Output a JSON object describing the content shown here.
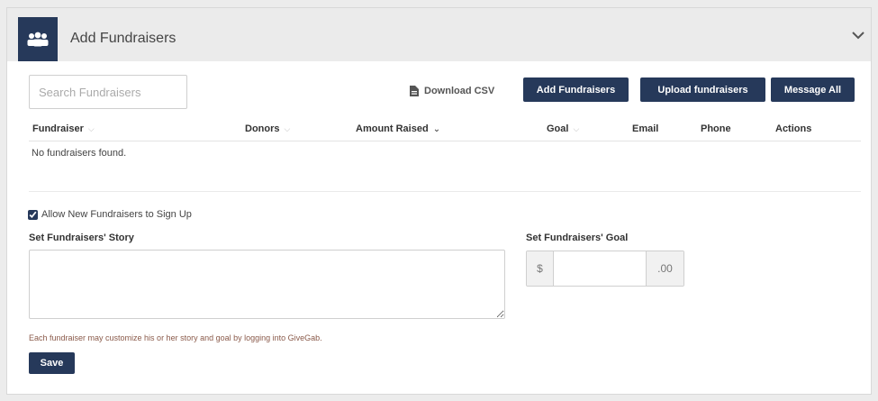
{
  "header": {
    "title": "Add Fundraisers",
    "icon": "group-icon",
    "collapse_icon": "chevron-down-icon"
  },
  "toolbar": {
    "search_placeholder": "Search Fundraisers",
    "download_label": "Download CSV",
    "download_icon": "document-icon",
    "add_label": "Add Fundraisers",
    "upload_label": "Upload fundraisers",
    "message_label": "Message All"
  },
  "table": {
    "columns": [
      {
        "label": "Fundraiser",
        "sortable": true,
        "active": false
      },
      {
        "label": "Donors",
        "sortable": true,
        "active": false
      },
      {
        "label": "Amount Raised",
        "sortable": true,
        "active": true
      },
      {
        "label": "Goal",
        "sortable": true,
        "active": false
      },
      {
        "label": "Email",
        "sortable": false,
        "active": false
      },
      {
        "label": "Phone",
        "sortable": false,
        "active": false
      },
      {
        "label": "Actions",
        "sortable": false,
        "active": false
      }
    ],
    "empty_message": "No fundraisers found."
  },
  "settings": {
    "allow_signup_label": "Allow New Fundraisers to Sign Up",
    "allow_signup_checked": true,
    "story_label": "Set Fundraisers' Story",
    "story_value": "",
    "goal_label": "Set Fundraisers' Goal",
    "goal_prefix": "$",
    "goal_value": "",
    "goal_suffix": ".00",
    "hint": "Each fundraiser may customize his or her story and goal by logging into GiveGab.",
    "save_label": "Save"
  },
  "colors": {
    "primary": "#26395a",
    "header_bg": "#ebebeb",
    "hint_text": "#8a5a4a"
  }
}
